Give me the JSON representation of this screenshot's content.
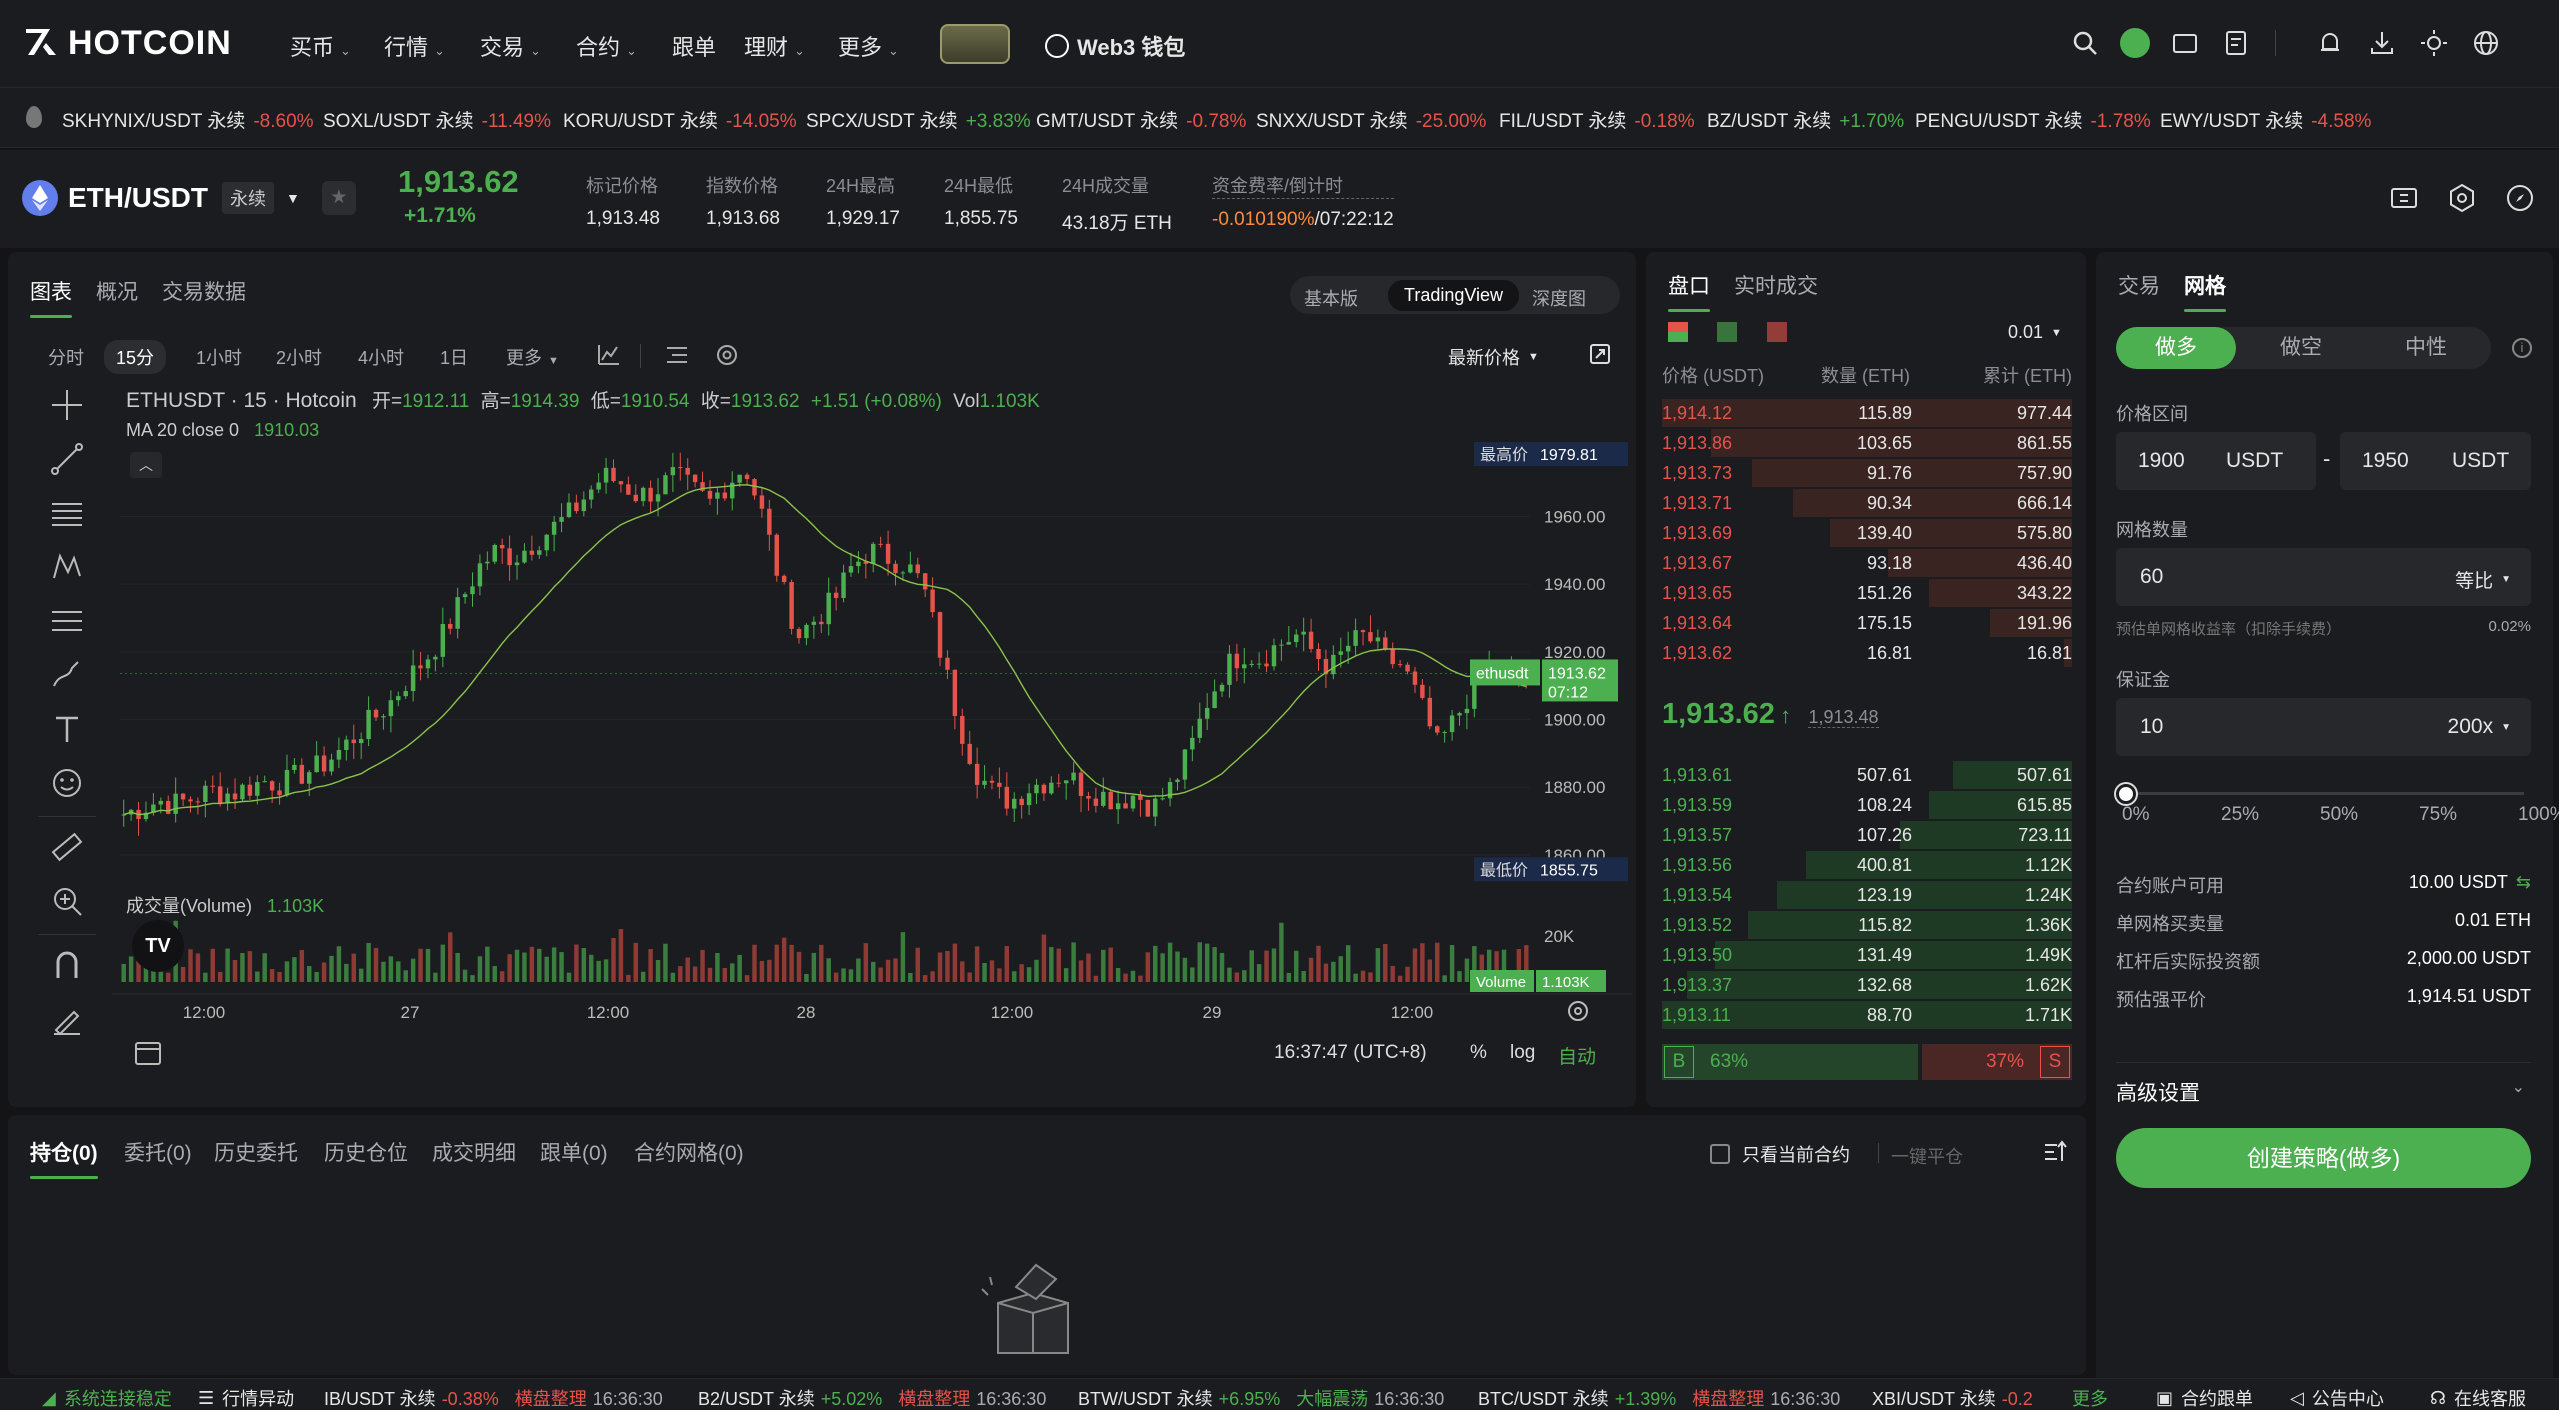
{
  "brand": "HOTCOIN",
  "nav": [
    {
      "label": "买币",
      "dropdown": true
    },
    {
      "label": "行情",
      "dropdown": true
    },
    {
      "label": "交易",
      "dropdown": true
    },
    {
      "label": "合约",
      "dropdown": true
    },
    {
      "label": "跟单",
      "dropdown": false
    },
    {
      "label": "理财",
      "dropdown": true
    },
    {
      "label": "更多",
      "dropdown": true
    }
  ],
  "web3_label": "Web3 钱包",
  "ticker": [
    {
      "symbol": "SKHYNIX/USDT 永续",
      "change": "-8.60%",
      "up": false
    },
    {
      "symbol": "SOXL/USDT 永续",
      "change": "-11.49%",
      "up": false
    },
    {
      "symbol": "KORU/USDT 永续",
      "change": "-14.05%",
      "up": false
    },
    {
      "symbol": "SPCX/USDT 永续",
      "change": "+3.83%",
      "up": true
    },
    {
      "symbol": "GMT/USDT 永续",
      "change": "-0.78%",
      "up": false
    },
    {
      "symbol": "SNXX/USDT 永续",
      "change": "-25.00%",
      "up": false
    },
    {
      "symbol": "FIL/USDT 永续",
      "change": "-0.18%",
      "up": false
    },
    {
      "symbol": "BZ/USDT 永续",
      "change": "+1.70%",
      "up": true
    },
    {
      "symbol": "PENGU/USDT 永续",
      "change": "-1.78%",
      "up": false
    },
    {
      "symbol": "EWY/USDT 永续",
      "change": "-4.58%",
      "up": false
    }
  ],
  "pair": {
    "symbol": "ETH/USDT",
    "type": "永续",
    "price": "1,913.62",
    "change": "+1.71%",
    "stats": [
      {
        "label": "标记价格",
        "value": "1,913.48"
      },
      {
        "label": "指数价格",
        "value": "1,913.68"
      },
      {
        "label": "24H最高",
        "value": "1,929.17"
      },
      {
        "label": "24H最低",
        "value": "1,855.75"
      },
      {
        "label": "24H成交量",
        "value": "43.18万 ETH"
      }
    ],
    "funding_label": "资金费率/倒计时",
    "funding_rate": "-0.010190%",
    "funding_countdown": "/07:22:12"
  },
  "chart_tabs": [
    "图表",
    "概况",
    "交易数据"
  ],
  "view_modes": [
    "基本版",
    "TradingView",
    "深度图"
  ],
  "intervals": [
    "分时",
    "15分",
    "1小时",
    "2小时",
    "4小时",
    "1日",
    "更多"
  ],
  "latest_price_label": "最新价格",
  "chart": {
    "legend": "ETHUSDT · 15 · Hotcoin",
    "ohlc": {
      "o_label": "开=",
      "o": "1912.11",
      "h_label": "高=",
      "h": "1914.39",
      "l_label": "低=",
      "l": "1910.54",
      "c_label": "收=",
      "c": "1913.62",
      "chg": "+1.51 (+0.08%)",
      "vol_label": "Vol",
      "vol": "1.103K"
    },
    "ma_label": "MA 20 close 0",
    "ma_value": "1910.03",
    "high_label": "最高价",
    "high_value": "1979.81",
    "low_label": "最低价",
    "low_value": "1855.75",
    "last_tag_name": "ethusdt",
    "last_tag_price": "1913.62",
    "last_tag_time": "07:12",
    "volume_label": "成交量(Volume)",
    "volume_value": "1.103K",
    "volume_tag": "Volume",
    "volume_tag_value": "1.103K",
    "vol_axis": "20K",
    "time": "16:37:47 (UTC+8)",
    "pct_label": "%",
    "log_label": "log",
    "auto_label": "自动"
  },
  "chart_data": {
    "type": "candlestick",
    "x_ticks": [
      "12:00",
      "27",
      "12:00",
      "28",
      "12:00",
      "29",
      "12:00"
    ],
    "y_ticks": [
      "1960.00",
      "1940.00",
      "1920.00",
      "1900.00",
      "1880.00",
      "1860.00"
    ],
    "ylim": [
      1852,
      1982
    ],
    "path_close": [
      1872,
      1874,
      1876,
      1875,
      1877,
      1879,
      1878,
      1880,
      1882,
      1881,
      1884,
      1886,
      1890,
      1895,
      1900,
      1905,
      1912,
      1918,
      1925,
      1935,
      1945,
      1950,
      1948,
      1952,
      1956,
      1960,
      1966,
      1972,
      1970,
      1966,
      1968,
      1972,
      1968,
      1964,
      1970,
      1975,
      1960,
      1940,
      1925,
      1930,
      1935,
      1945,
      1950,
      1948,
      1946,
      1940,
      1920,
      1900,
      1885,
      1878,
      1876,
      1880,
      1882,
      1884,
      1880,
      1878,
      1876,
      1878,
      1874,
      1880,
      1890,
      1905,
      1915,
      1920,
      1918,
      1922,
      1925,
      1920,
      1915,
      1922,
      1925,
      1918,
      1916,
      1905,
      1892,
      1900,
      1910,
      1915,
      1913,
      1914
    ]
  },
  "orderbook": {
    "tabs": [
      "盘口",
      "实时成交"
    ],
    "precision": "0.01",
    "headers": [
      "价格 (USDT)",
      "数量 (ETH)",
      "累计 (ETH)"
    ],
    "asks": [
      {
        "p": "1,914.12",
        "q": "115.89",
        "c": "977.44",
        "d": 1.0
      },
      {
        "p": "1,913.86",
        "q": "103.65",
        "c": "861.55",
        "d": 0.88
      },
      {
        "p": "1,913.73",
        "q": "91.76",
        "c": "757.90",
        "d": 0.78
      },
      {
        "p": "1,913.71",
        "q": "90.34",
        "c": "666.14",
        "d": 0.68
      },
      {
        "p": "1,913.69",
        "q": "139.40",
        "c": "575.80",
        "d": 0.59
      },
      {
        "p": "1,913.67",
        "q": "93.18",
        "c": "436.40",
        "d": 0.45
      },
      {
        "p": "1,913.65",
        "q": "151.26",
        "c": "343.22",
        "d": 0.35
      },
      {
        "p": "1,913.64",
        "q": "175.15",
        "c": "191.96",
        "d": 0.2
      },
      {
        "p": "1,913.62",
        "q": "16.81",
        "c": "16.81",
        "d": 0.02
      }
    ],
    "mid_price": "1,913.62",
    "mid_arrow": "↑",
    "mid_mark": "1,913.48",
    "bids": [
      {
        "p": "1,913.61",
        "q": "507.61",
        "c": "507.61",
        "d": 0.29
      },
      {
        "p": "1,913.59",
        "q": "108.24",
        "c": "615.85",
        "d": 0.35
      },
      {
        "p": "1,913.57",
        "q": "107.26",
        "c": "723.11",
        "d": 0.42
      },
      {
        "p": "1,913.56",
        "q": "400.81",
        "c": "1.12K",
        "d": 0.65
      },
      {
        "p": "1,913.54",
        "q": "123.19",
        "c": "1.24K",
        "d": 0.72
      },
      {
        "p": "1,913.52",
        "q": "115.82",
        "c": "1.36K",
        "d": 0.79
      },
      {
        "p": "1,913.50",
        "q": "131.49",
        "c": "1.49K",
        "d": 0.87
      },
      {
        "p": "1,913.37",
        "q": "132.68",
        "c": "1.62K",
        "d": 0.94
      },
      {
        "p": "1,913.11",
        "q": "88.70",
        "c": "1.71K",
        "d": 1.0
      }
    ],
    "buy_letter": "B",
    "buy_pct": "63%",
    "buy_ratio": 0.63,
    "sell_pct": "37%",
    "sell_letter": "S"
  },
  "order": {
    "tabs": [
      "交易",
      "网格"
    ],
    "modes": [
      "做多",
      "做空",
      "中性"
    ],
    "price_range_label": "价格区间",
    "low": "1900",
    "high": "1950",
    "unit": "USDT",
    "dash": "-",
    "grid_count_label": "网格数量",
    "grid_count": "60",
    "grid_type": "等比",
    "profit_label": "预估单网格收益率（扣除手续费）",
    "profit_value": "0.02%",
    "margin_label": "保证金",
    "margin": "10",
    "leverage": "200x",
    "slider_value": 0,
    "slider_ticks": [
      "0%",
      "25%",
      "50%",
      "75%",
      "100%"
    ],
    "info": [
      {
        "k": "合约账户可用",
        "v": "10.00 USDT"
      },
      {
        "k": "单网格买卖量",
        "v": "0.01 ETH"
      },
      {
        "k": "杠杆后实际投资额",
        "v": "2,000.00 USDT"
      },
      {
        "k": "预估强平价",
        "v": "1,914.51 USDT"
      }
    ],
    "advanced_label": "高级设置",
    "submit_label": "创建策略(做多)"
  },
  "positions": {
    "tabs": [
      "持仓(0)",
      "委托(0)",
      "历史委托",
      "历史仓位",
      "成交明细",
      "跟单(0)",
      "合约网格(0)"
    ],
    "only_current_label": "只看当前合约",
    "close_all_label": "一键平仓"
  },
  "footer": {
    "status": "系统连接稳定",
    "alerts": "行情异动",
    "items": [
      {
        "sym": "IB/USDT 永续",
        "chg": "-0.38%",
        "up": false,
        "tag": "横盘整理",
        "time": "16:36:30"
      },
      {
        "sym": "B2/USDT 永续",
        "chg": "+5.02%",
        "up": true,
        "tag": "横盘整理",
        "time": "16:36:30"
      },
      {
        "sym": "BTW/USDT 永续",
        "chg": "+6.95%",
        "up": true,
        "tag": "大幅震荡",
        "time": "16:36:30"
      },
      {
        "sym": "BTC/USDT 永续",
        "chg": "+1.39%",
        "up": true,
        "tag": "横盘整理",
        "time": "16:36:30"
      },
      {
        "sym": "XBI/USDT 永续",
        "chg": "-0.2",
        "up": false,
        "tag": "",
        "time": ""
      }
    ],
    "more": "更多",
    "copy_trading": "合约跟单",
    "announcements": "公告中心",
    "support": "在线客服"
  },
  "colors": {
    "green": "#4caf50",
    "red": "#e5534b",
    "bg": "#141416",
    "panel": "#1b1c1f"
  }
}
